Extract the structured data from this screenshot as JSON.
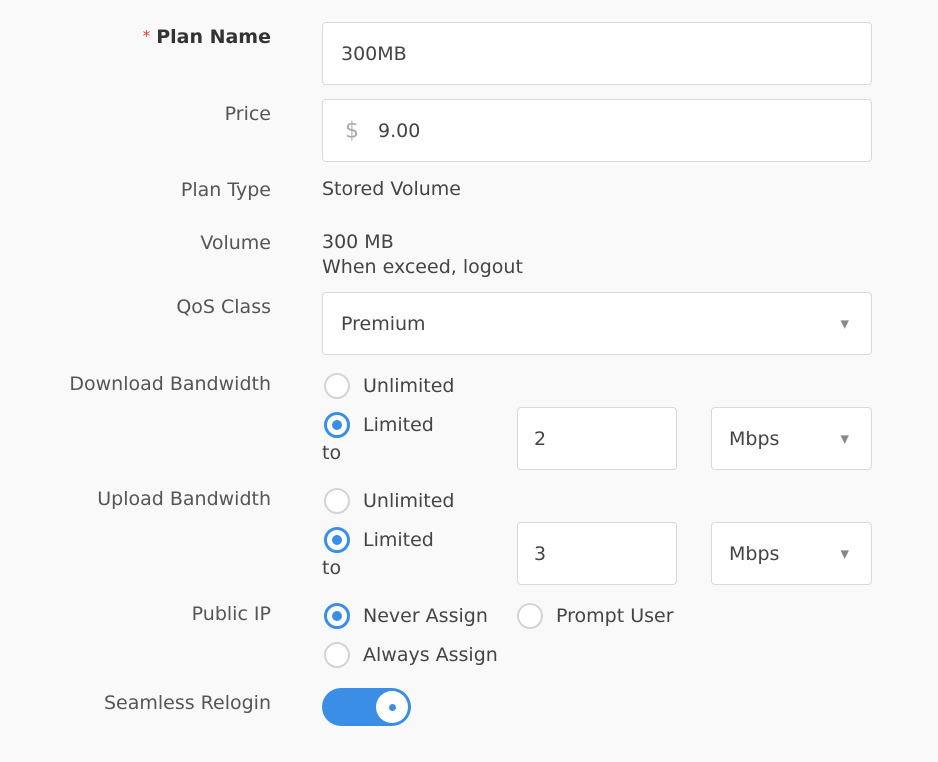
{
  "plan_name": {
    "label": "Plan Name",
    "required_mark": "*",
    "value": "300MB"
  },
  "price": {
    "label": "Price",
    "currency": "$",
    "value": "9.00"
  },
  "plan_type": {
    "label": "Plan Type",
    "value": "Stored Volume"
  },
  "volume": {
    "label": "Volume",
    "amount": "300 MB",
    "on_exceed": "When exceed,  logout"
  },
  "qos": {
    "label": "QoS Class",
    "value": "Premium"
  },
  "download": {
    "label": "Download Bandwidth",
    "unlimited": "Unlimited",
    "limited": "Limited",
    "to": "to",
    "selected": "limited",
    "value": "2",
    "unit": "Mbps"
  },
  "upload": {
    "label": "Upload Bandwidth",
    "unlimited": "Unlimited",
    "limited": "Limited",
    "to": "to",
    "selected": "limited",
    "value": "3",
    "unit": "Mbps"
  },
  "public_ip": {
    "label": "Public IP",
    "options": [
      "Never Assign",
      "Prompt User",
      "Always Assign"
    ],
    "selected": "Never Assign"
  },
  "seamless_relogin": {
    "label": "Seamless Relogin",
    "enabled": true
  },
  "colors": {
    "accent": "#3a8ee6",
    "required": "#e53935"
  },
  "icons": {
    "select": "chevron-down-icon",
    "currency": "dollar-icon"
  }
}
